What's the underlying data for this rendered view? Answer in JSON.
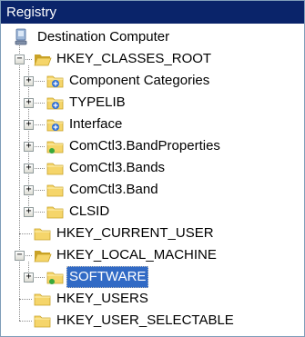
{
  "window": {
    "title": "Registry"
  },
  "tree": {
    "root": {
      "label": "Destination Computer",
      "icon": "computer-icon"
    },
    "nodes": [
      {
        "key": "hkcr",
        "label": "HKEY_CLASSES_ROOT",
        "level": 1,
        "toggle": "-",
        "icon": "folder-open-icon"
      },
      {
        "key": "component-categories",
        "label": "Component Categories",
        "level": 2,
        "toggle": "+",
        "icon": "folder-link-icon"
      },
      {
        "key": "typelib",
        "label": "TYPELIB",
        "level": 2,
        "toggle": "+",
        "icon": "folder-link-icon"
      },
      {
        "key": "interface",
        "label": "Interface",
        "level": 2,
        "toggle": "+",
        "icon": "folder-link-icon"
      },
      {
        "key": "comctl3-bandproperties",
        "label": "ComCtl3.BandProperties",
        "level": 2,
        "toggle": "+",
        "icon": "folder-green-icon"
      },
      {
        "key": "comctl3-bands",
        "label": "ComCtl3.Bands",
        "level": 2,
        "toggle": "+",
        "icon": "folder-icon"
      },
      {
        "key": "comctl3-band",
        "label": "ComCtl3.Band",
        "level": 2,
        "toggle": "+",
        "icon": "folder-icon"
      },
      {
        "key": "clsid",
        "label": "CLSID",
        "level": 2,
        "toggle": "+",
        "icon": "folder-icon"
      },
      {
        "key": "hkcu",
        "label": "HKEY_CURRENT_USER",
        "level": 1,
        "toggle": "",
        "icon": "folder-icon"
      },
      {
        "key": "hklm",
        "label": "HKEY_LOCAL_MACHINE",
        "level": 1,
        "toggle": "-",
        "icon": "folder-open-icon"
      },
      {
        "key": "software",
        "label": "SOFTWARE",
        "level": 2,
        "toggle": "+",
        "icon": "folder-green-icon",
        "selected": true
      },
      {
        "key": "hku",
        "label": "HKEY_USERS",
        "level": 1,
        "toggle": "",
        "icon": "folder-icon"
      },
      {
        "key": "hkus",
        "label": "HKEY_USER_SELECTABLE",
        "level": 1,
        "toggle": "",
        "icon": "folder-icon"
      }
    ]
  },
  "colors": {
    "titlebar": "#0a246a",
    "selection": "#316ac5",
    "folder": "#f5d56a",
    "folder_dark": "#c9a227",
    "overlay_blue": "#2f6fd6",
    "overlay_green": "#3aa93a"
  }
}
